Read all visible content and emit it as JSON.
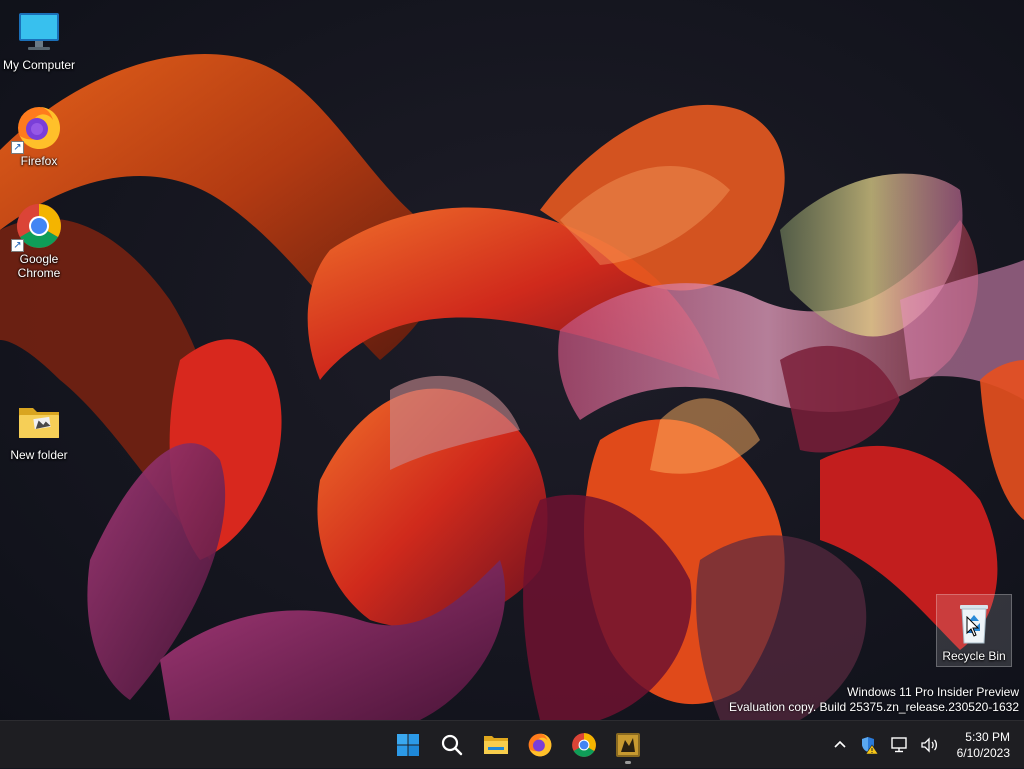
{
  "desktop": {
    "icons": [
      {
        "label": "My Computer",
        "icon": "monitor-icon"
      },
      {
        "label": "Firefox",
        "icon": "firefox-icon"
      },
      {
        "label": "Google Chrome",
        "icon": "chrome-icon"
      },
      {
        "label": "New folder",
        "icon": "folder-icon"
      },
      {
        "label": "Recycle Bin",
        "icon": "recycle-bin-icon"
      }
    ]
  },
  "watermark": {
    "line1": "Windows 11 Pro Insider Preview",
    "line2": "Evaluation copy. Build 25375.zn_release.230520-1632"
  },
  "taskbar": {
    "apps": [
      "start-icon",
      "search-icon",
      "file-explorer-icon",
      "firefox-icon",
      "chrome-icon",
      "app-icon"
    ],
    "tray": [
      "chevron-up-icon",
      "security-warning-icon",
      "network-icon",
      "speaker-icon"
    ],
    "time": "5:30 PM",
    "date": "6/10/2023"
  },
  "colors": {
    "taskbar_bg": "#1e1e22",
    "wallpaper_bg": "#14161f",
    "accent_blue": "#0078d4"
  }
}
